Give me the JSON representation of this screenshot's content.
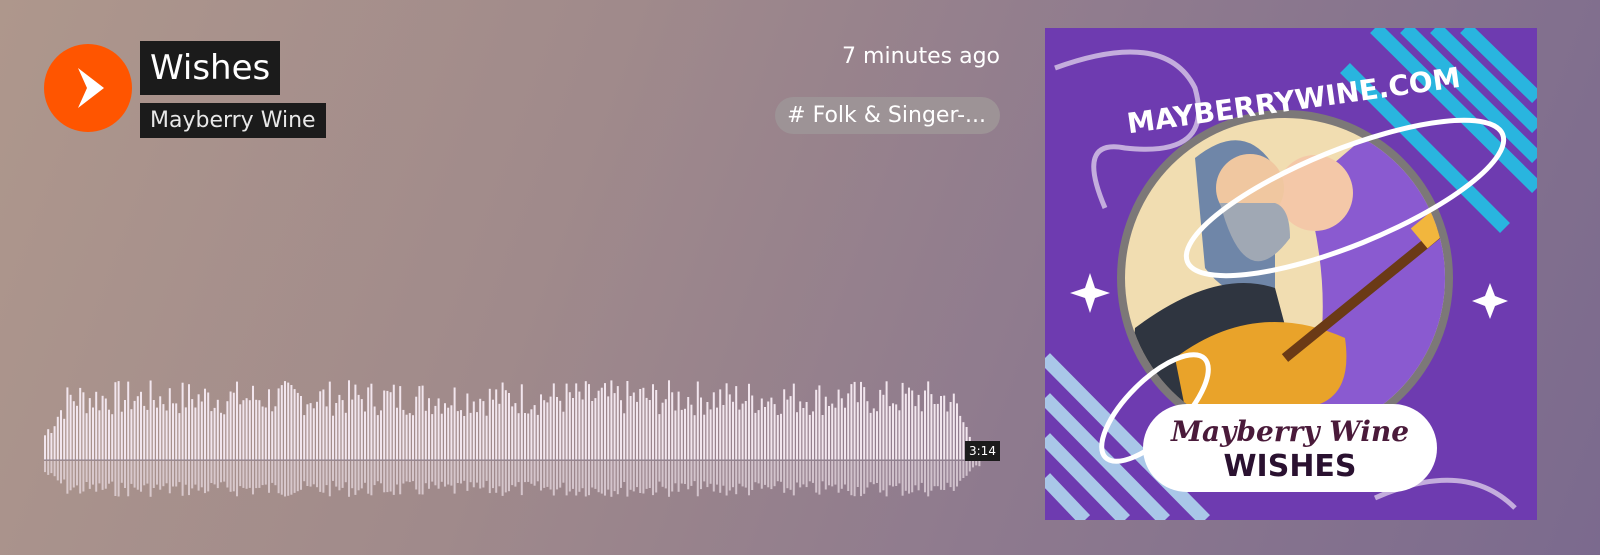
{
  "track": {
    "title": "Wishes",
    "artist": "Mayberry Wine",
    "posted": "7 minutes ago",
    "tag": "# Folk & Singer-...",
    "duration": "3:14"
  },
  "icons": {
    "play": "play-icon"
  },
  "cover": {
    "site_text": "MAYBERRYWINE.COM",
    "band_text": "Mayberry Wine",
    "song_text": "WISHES"
  },
  "colors": {
    "accent": "#ff5500",
    "label_bg": "#1b1b1b",
    "waveform": "#f2e6ee",
    "cover_bg": "#6e3bb0"
  }
}
